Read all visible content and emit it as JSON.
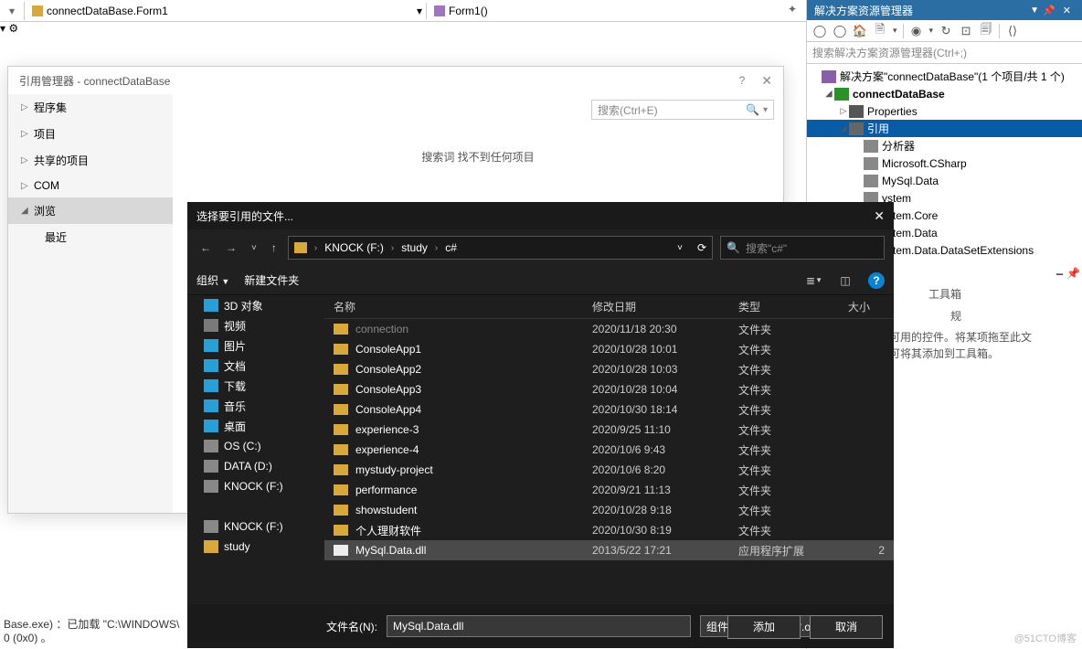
{
  "topbar": {
    "breadcrumb1": "connectDataBase.Form1",
    "breadcrumb2": "Form1()"
  },
  "refManager": {
    "title": "引用管理器 - connectDataBase",
    "searchPlaceholder": "搜索(Ctrl+E)",
    "message": "搜索词  找不到任何项目",
    "sidebar": [
      "程序集",
      "项目",
      "共享的项目",
      "COM",
      "浏览"
    ],
    "sidebarSub": "最近"
  },
  "fileDialog": {
    "title": "选择要引用的文件...",
    "path": [
      "KNOCK (F:)",
      "study",
      "c#"
    ],
    "searchPlaceholder": "搜索\"c#\"",
    "toolbar": {
      "organize": "组织",
      "newFolder": "新建文件夹"
    },
    "columns": {
      "name": "名称",
      "date": "修改日期",
      "type": "类型",
      "size": "大小"
    },
    "side": [
      {
        "label": "3D 对象",
        "cls": "ic-3d"
      },
      {
        "label": "视频",
        "cls": "ic-video"
      },
      {
        "label": "图片",
        "cls": "ic-pic"
      },
      {
        "label": "文档",
        "cls": "ic-doc"
      },
      {
        "label": "下载",
        "cls": "ic-dl"
      },
      {
        "label": "音乐",
        "cls": "ic-music"
      },
      {
        "label": "桌面",
        "cls": "ic-desk"
      },
      {
        "label": "OS (C:)",
        "cls": "ic-drive"
      },
      {
        "label": "DATA (D:)",
        "cls": "ic-drive"
      },
      {
        "label": "KNOCK (F:)",
        "cls": "ic-drive"
      },
      {
        "label": "",
        "cls": ""
      },
      {
        "label": "KNOCK (F:)",
        "cls": "ic-drive"
      },
      {
        "label": "study",
        "cls": "ic-folder"
      }
    ],
    "rows": [
      {
        "name": "connection",
        "date": "2020/11/18 20:30",
        "type": "文件夹",
        "dim": true,
        "size": ""
      },
      {
        "name": "ConsoleApp1",
        "date": "2020/10/28 10:01",
        "type": "文件夹",
        "size": ""
      },
      {
        "name": "ConsoleApp2",
        "date": "2020/10/28 10:03",
        "type": "文件夹",
        "size": ""
      },
      {
        "name": "ConsoleApp3",
        "date": "2020/10/28 10:04",
        "type": "文件夹",
        "size": ""
      },
      {
        "name": "ConsoleApp4",
        "date": "2020/10/30 18:14",
        "type": "文件夹",
        "size": ""
      },
      {
        "name": "experience-3",
        "date": "2020/9/25 11:10",
        "type": "文件夹",
        "size": ""
      },
      {
        "name": "experience-4",
        "date": "2020/10/6 9:43",
        "type": "文件夹",
        "size": ""
      },
      {
        "name": "mystudy-project",
        "date": "2020/10/6 8:20",
        "type": "文件夹",
        "size": ""
      },
      {
        "name": "performance",
        "date": "2020/9/21 11:13",
        "type": "文件夹",
        "size": ""
      },
      {
        "name": "showstudent",
        "date": "2020/10/28 9:18",
        "type": "文件夹",
        "size": ""
      },
      {
        "name": "个人理财软件",
        "date": "2020/10/30 8:19",
        "type": "文件夹",
        "size": ""
      },
      {
        "name": "MySql.Data.dll",
        "date": "2013/5/22 17:21",
        "type": "应用程序扩展",
        "dll": true,
        "sel": true,
        "size": "2"
      }
    ],
    "fileNameLabel": "文件名(N):",
    "fileNameValue": "MySql.Data.dll",
    "filter": "组件文件(*.dll;*.tlb;*.olb;*.ocx",
    "addBtn": "添加",
    "cancelBtn": "取消"
  },
  "solutionExplorer": {
    "title": "解决方案资源管理器",
    "searchPlaceholder": "搜索解决方案资源管理器(Ctrl+;)",
    "solutionLabel": "解决方案\"connectDataBase\"(1 个项目/共 1 个)",
    "projectLabel": "connectDataBase",
    "propertiesLabel": "Properties",
    "referencesLabel": "引用",
    "refs": [
      "分析器",
      "Microsoft.CSharp",
      "MySql.Data",
      "ystem",
      "ystem.Core",
      "ystem.Data",
      "ystem.Data.DataSetExtensions"
    ]
  },
  "toolbox": {
    "title1": "工具箱",
    "title2": "规",
    "hint1": "中没有可用的控件。将某项拖至此文",
    "hint2": "可将其添加到工具箱。"
  },
  "output": {
    "line1": "Base.exe) ：已加载 \"C:\\WINDOWS\\",
    "line2": "0 (0x0) 。"
  },
  "watermark": "@51CTO博客"
}
